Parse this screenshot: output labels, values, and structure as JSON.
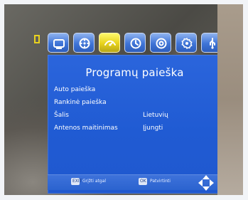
{
  "status": {
    "channel_text": ""
  },
  "menu": {
    "tabs": [
      {
        "icon": "tv-icon",
        "active": false
      },
      {
        "icon": "film-reel-icon",
        "active": false
      },
      {
        "icon": "satellite-search-icon",
        "active": true
      },
      {
        "icon": "clock-icon",
        "active": false
      },
      {
        "icon": "target-settings-icon",
        "active": false
      },
      {
        "icon": "gear-icon",
        "active": false
      },
      {
        "icon": "usb-icon",
        "active": false
      }
    ]
  },
  "panel": {
    "title": "Programų paieška",
    "rows": [
      {
        "label": "Auto paieška",
        "value": ""
      },
      {
        "label": "Rankinė paieška",
        "value": ""
      },
      {
        "label": "Šalis",
        "value": "Lietuvių"
      },
      {
        "label": "Antenos maitinimas",
        "value": "Įjungti"
      }
    ],
    "footer": {
      "key1": "EXIT",
      "hint1": "Grįžti atgal",
      "key2": "OK",
      "hint2": "Patvirtinti"
    }
  },
  "colors": {
    "panel_blue": "#205bd3",
    "tab_active_yellow": "#e7d21b",
    "tab_inactive_blue": "#3f74d7"
  }
}
